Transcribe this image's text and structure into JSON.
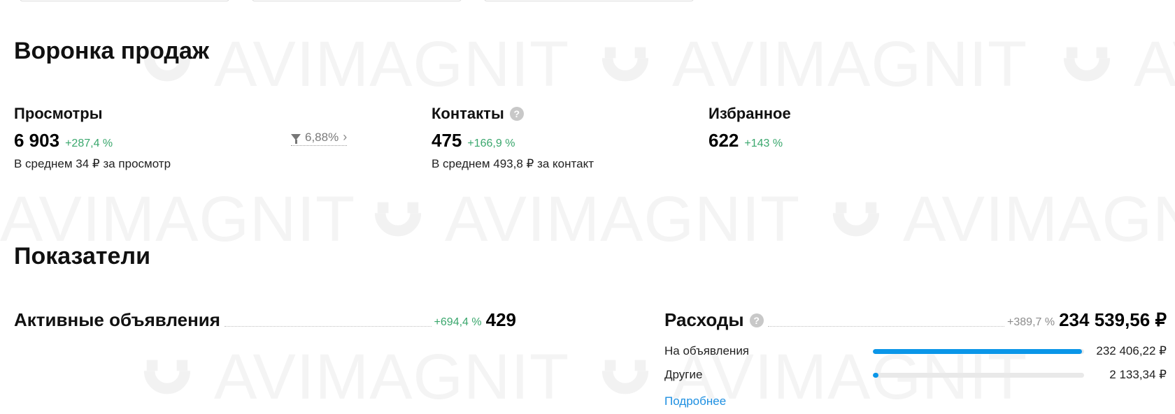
{
  "watermark": {
    "text": "AVIMAGNIT"
  },
  "funnel": {
    "title": "Воронка продаж",
    "views": {
      "label": "Просмотры",
      "value": "6 903",
      "delta": "+287,4 %",
      "sub": "В среднем 34 ₽ за просмотр"
    },
    "conversion": {
      "value": "6,88%",
      "icon": "funnel-icon"
    },
    "contacts": {
      "label": "Контакты",
      "value": "475",
      "delta": "+166,9 %",
      "sub": "В среднем 493,8 ₽ за контакт",
      "help": "?"
    },
    "favorites": {
      "label": "Избранное",
      "value": "622",
      "delta": "+143 %"
    }
  },
  "indicators": {
    "title": "Показатели",
    "active_ads": {
      "label": "Активные объявления",
      "delta": "+694,4 %",
      "value": "429"
    },
    "expenses": {
      "label": "Расходы",
      "help": "?",
      "delta": "+389,7 %",
      "value": "234 539,56 ₽",
      "items": [
        {
          "label": "На объявления",
          "amount": "232 406,22 ₽",
          "share": 0.99
        },
        {
          "label": "Другие",
          "amount": "2 133,34 ₽",
          "share": 0.01
        }
      ],
      "more_link": "Подробнее"
    }
  },
  "colors": {
    "positive": "#3aa76d",
    "accent_bar": "#0a96e8",
    "link": "#1d8fe1"
  }
}
